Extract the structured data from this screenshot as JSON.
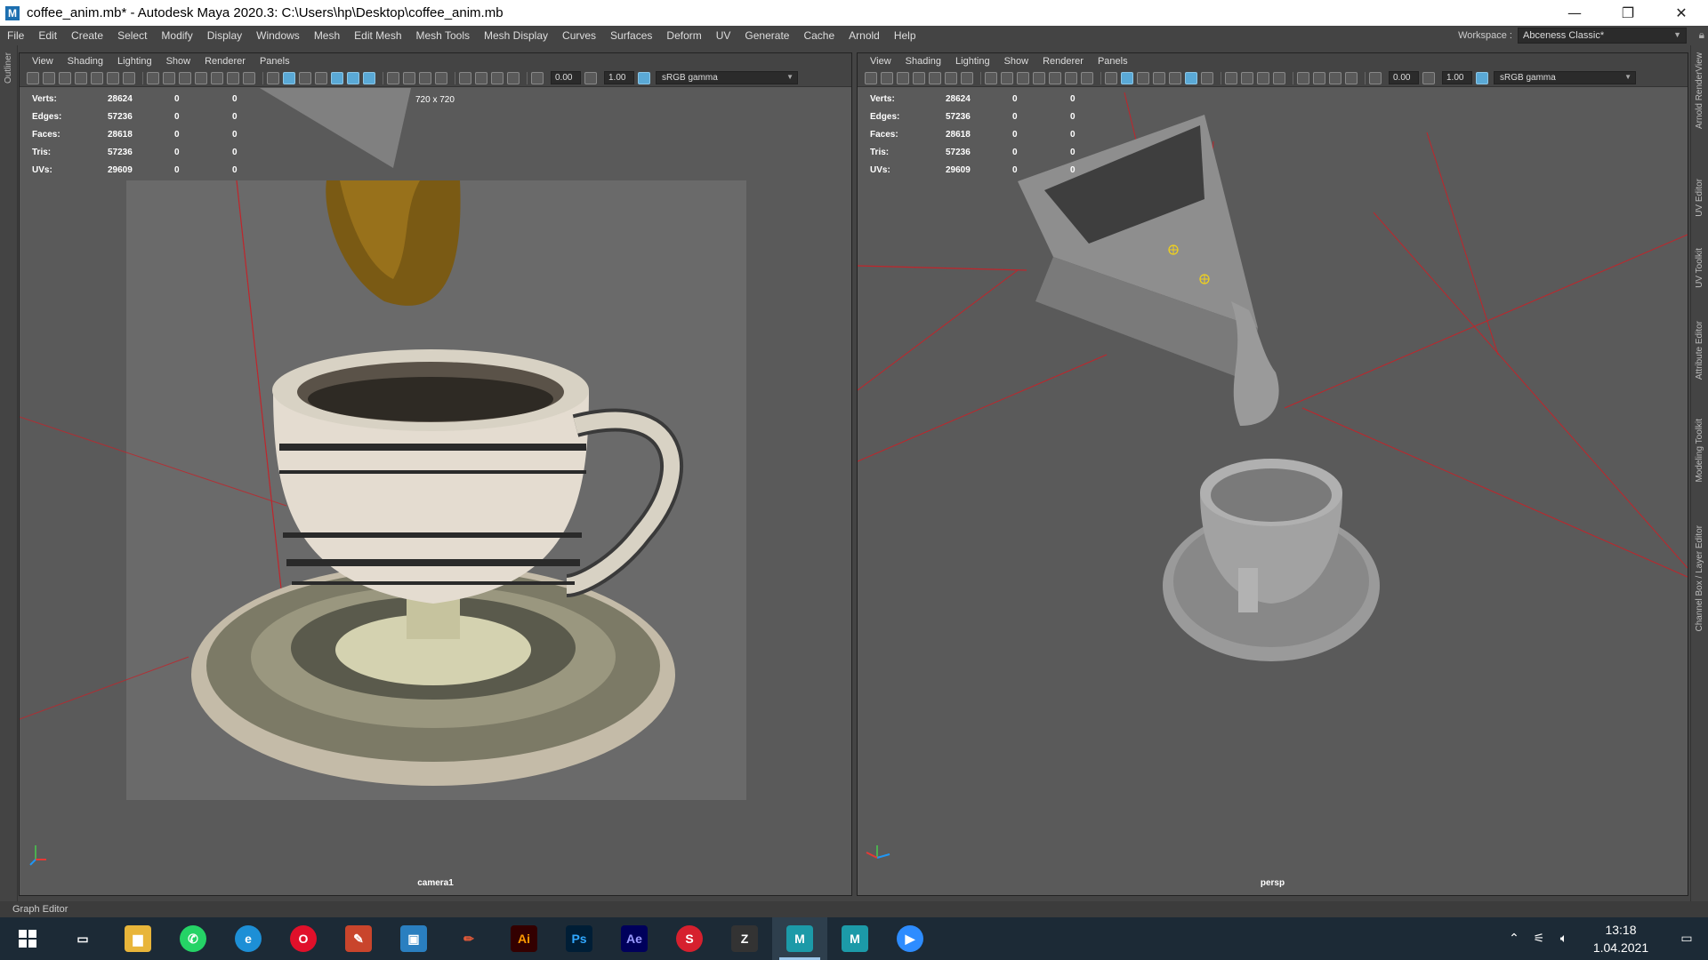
{
  "window": {
    "app_letter": "M",
    "title": "coffee_anim.mb* - Autodesk Maya 2020.3: C:\\Users\\hp\\Desktop\\coffee_anim.mb",
    "minimize": "—",
    "restore": "❐",
    "close": "✕"
  },
  "menubar": {
    "items": [
      "File",
      "Edit",
      "Create",
      "Select",
      "Modify",
      "Display",
      "Windows",
      "Mesh",
      "Edit Mesh",
      "Mesh Tools",
      "Mesh Display",
      "Curves",
      "Surfaces",
      "Deform",
      "UV",
      "Generate",
      "Cache",
      "Arnold",
      "Help"
    ],
    "workspace_label": "Workspace :",
    "workspace_value": "Abceness Classic*"
  },
  "left_strip": {
    "label": "Outliner"
  },
  "right_strip": {
    "tabs": [
      "Arnold RenderView",
      "UV Editor",
      "UV Toolkit",
      "Attribute Editor",
      "Modeling Toolkit",
      "Channel Box / Layer Editor"
    ]
  },
  "panel_menus": [
    "View",
    "Shading",
    "Lighting",
    "Show",
    "Renderer",
    "Panels"
  ],
  "toolbar": {
    "field_a": "0.00",
    "field_b": "1.00",
    "gamma": "sRGB gamma"
  },
  "hud": {
    "rows": [
      {
        "label": "Verts:",
        "v1": "28624",
        "v2": "0",
        "v3": "0"
      },
      {
        "label": "Edges:",
        "v1": "57236",
        "v2": "0",
        "v3": "0"
      },
      {
        "label": "Faces:",
        "v1": "28618",
        "v2": "0",
        "v3": "0"
      },
      {
        "label": "Tris:",
        "v1": "57236",
        "v2": "0",
        "v3": "0"
      },
      {
        "label": "UVs:",
        "v1": "29609",
        "v2": "0",
        "v3": "0"
      }
    ]
  },
  "left_view": {
    "camera": "camera1",
    "resolution": "720 x 720"
  },
  "right_view": {
    "camera": "persp"
  },
  "bottom_label": "Graph Editor",
  "taskbar": {
    "apps": [
      {
        "name": "task-view",
        "glyph": "▭",
        "color": "#1c2a36"
      },
      {
        "name": "file-explorer",
        "glyph": "▆",
        "color": "#e8b53a"
      },
      {
        "name": "whatsapp",
        "glyph": "✆",
        "color": "#25d366"
      },
      {
        "name": "edge",
        "glyph": "e",
        "color": "#1d8fd6"
      },
      {
        "name": "opera",
        "glyph": "O",
        "color": "#e0102a"
      },
      {
        "name": "paint",
        "glyph": "✎",
        "color": "#c9452c"
      },
      {
        "name": "notes",
        "glyph": "▣",
        "color": "#2a7fc0"
      },
      {
        "name": "pencil",
        "glyph": "✏",
        "color": "#1c2a36"
      },
      {
        "name": "illustrator",
        "glyph": "Ai",
        "color": "#330000"
      },
      {
        "name": "photoshop",
        "glyph": "Ps",
        "color": "#001e36"
      },
      {
        "name": "after-effects",
        "glyph": "Ae",
        "color": "#00005b"
      },
      {
        "name": "substance",
        "glyph": "S",
        "color": "#d6202e"
      },
      {
        "name": "zbrush",
        "glyph": "Z",
        "color": "#333333"
      },
      {
        "name": "maya-active",
        "glyph": "M",
        "color": "#1c9aa8"
      },
      {
        "name": "maya-2",
        "glyph": "M",
        "color": "#1c9aa8"
      },
      {
        "name": "zoom",
        "glyph": "▶",
        "color": "#2d8cff"
      }
    ],
    "time": "13:18",
    "date": "1.04.2021"
  },
  "colors": {
    "accent": "#5aa9d6",
    "camera_lines": "#c0252b",
    "selected_handle": "#f2d21a"
  }
}
